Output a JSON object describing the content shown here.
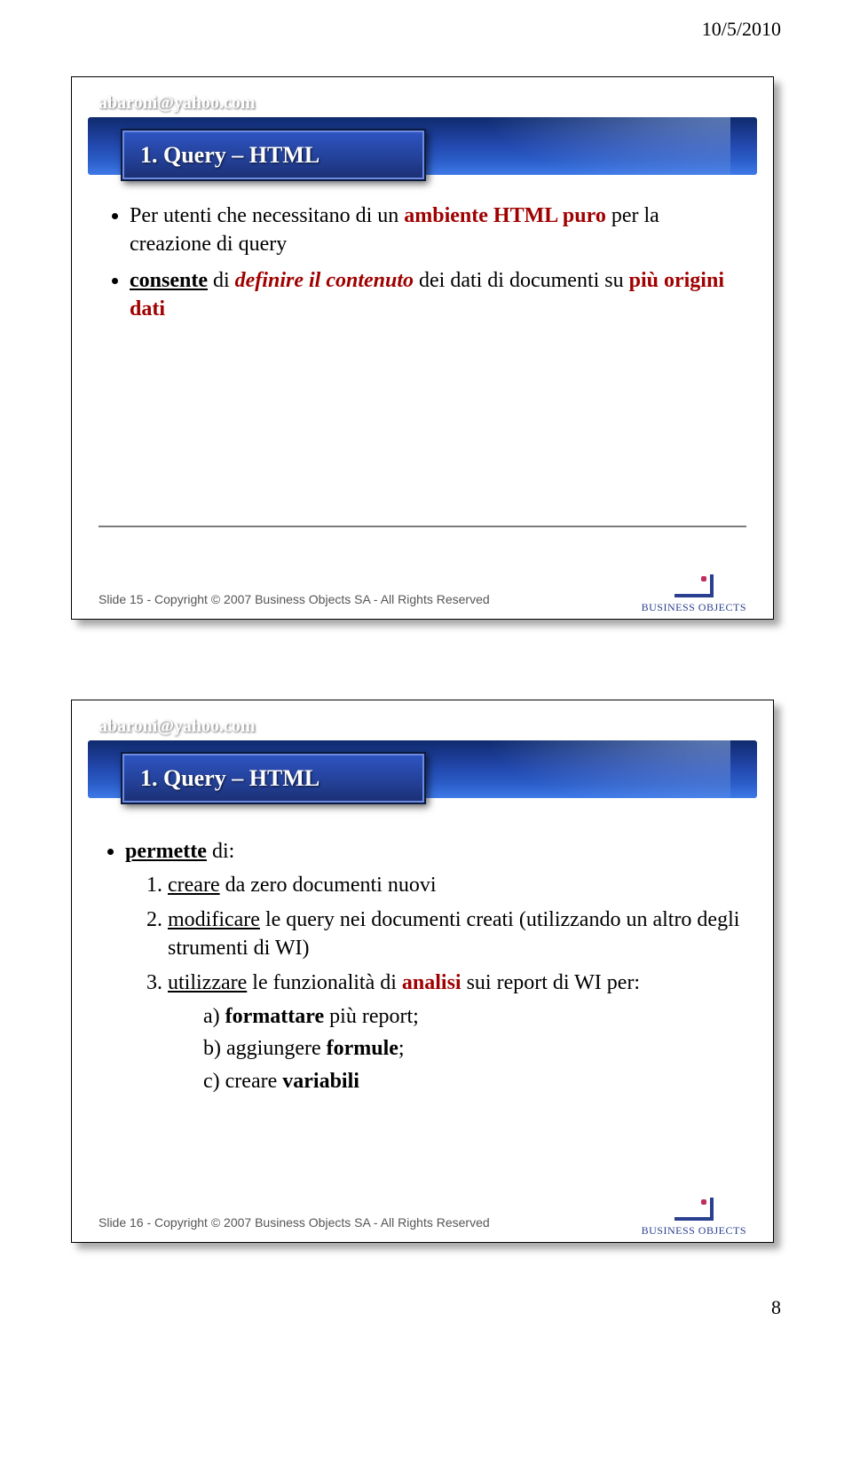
{
  "doc": {
    "date": "10/5/2010",
    "page_number": "8"
  },
  "slide1": {
    "email": "abaroni@yahoo.com",
    "title": "1. Query – HTML",
    "bullets": {
      "line1": {
        "pre": "Per  utenti che necessitano di un ",
        "em": "ambiente HTML puro",
        "post": " per la creazione di query"
      },
      "line2": {
        "ul1": "consente",
        "mid1": " di ",
        "em1": "definire il contenuto",
        "mid2": " dei dati di documenti su ",
        "em2": "più origini dati"
      }
    },
    "footer": "Slide 15 - Copyright © 2007 Business Objects SA - All Rights Reserved",
    "logo": "BUSINESS OBJECTS"
  },
  "slide2": {
    "email": "abaroni@yahoo.com",
    "title": "1. Query – HTML",
    "top": {
      "label": "permette",
      "suffix": " di:"
    },
    "items": [
      {
        "ul": "creare",
        "rest": " da zero documenti nuovi"
      },
      {
        "ul": "modificare",
        "rest": " le query nei documenti creati (utilizzando un altro degli strumenti di WI)"
      },
      {
        "ul": "utilizzare",
        "mid": " le funzionalità di ",
        "em": "analisi",
        "post": " sui report di WI per:"
      }
    ],
    "sub": [
      {
        "prefix": "a) ",
        "bold": "formattare",
        "rest": " più report;"
      },
      {
        "prefix": "b) aggiungere ",
        "bold": "formule",
        "rest": ";"
      },
      {
        "prefix": "c) creare ",
        "bold": "variabili",
        "rest": ""
      }
    ],
    "footer": "Slide 16 - Copyright © 2007 Business Objects SA - All Rights Reserved",
    "logo": "BUSINESS OBJECTS"
  }
}
